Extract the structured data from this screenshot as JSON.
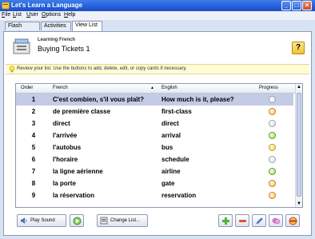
{
  "window": {
    "title": "Let's Learn a Language"
  },
  "menu": [
    "File",
    "List",
    "User",
    "Options",
    "Help"
  ],
  "tabs": [
    "Flash Cards",
    "Activities",
    "View List"
  ],
  "header": {
    "subtitle": "Learning French",
    "title": "Buying Tickets 1",
    "help_label": "?"
  },
  "hint": "Review your list. Use the buttons to add, delete, edit, or copy cards if necessary.",
  "table": {
    "columns": {
      "order": "Order",
      "french": "French",
      "english": "English",
      "progress": "Progress",
      "sort_indicator": "▲"
    },
    "rows": [
      {
        "n": "1",
        "fr": "C'est combien, s'il vous plaît?",
        "en": "How much is it, please?",
        "progress": "empty"
      },
      {
        "n": "2",
        "fr": "de première classe",
        "en": "first-class",
        "progress": "orange"
      },
      {
        "n": "3",
        "fr": "direct",
        "en": "direct",
        "progress": "empty"
      },
      {
        "n": "4",
        "fr": "l'arrivée",
        "en": "arrival",
        "progress": "green"
      },
      {
        "n": "5",
        "fr": "l'autobus",
        "en": "bus",
        "progress": "yellow"
      },
      {
        "n": "6",
        "fr": "l'horaire",
        "en": "schedule",
        "progress": "empty"
      },
      {
        "n": "7",
        "fr": "la ligne aérienne",
        "en": "airline",
        "progress": "green"
      },
      {
        "n": "8",
        "fr": "la porte",
        "en": "gate",
        "progress": "orange"
      },
      {
        "n": "9",
        "fr": "la réservation",
        "en": "reservation",
        "progress": "orange"
      }
    ]
  },
  "footer": {
    "play_sound": "Play Sound",
    "change_list": "Change List..."
  },
  "colors": {
    "accent": "#245edb",
    "selected_row": "#c3cbe6"
  }
}
